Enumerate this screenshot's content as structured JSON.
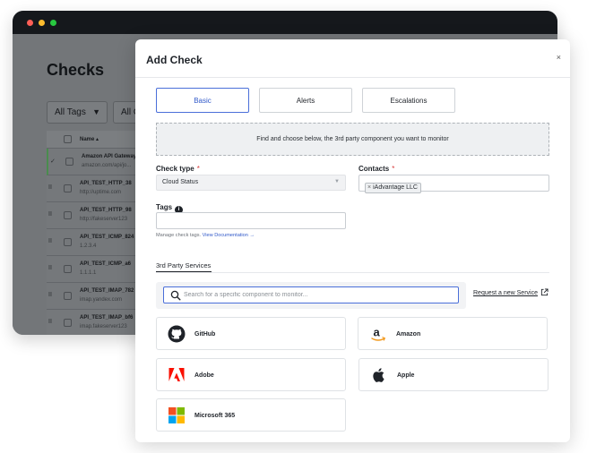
{
  "background_app": {
    "title": "Checks",
    "filter_all_tags": "All Tags",
    "filter_second": "All C",
    "table_header_name": "Name ▴",
    "rows": [
      {
        "name": "Amazon API Gateway",
        "sub": "amazon.com/api/jo...",
        "lead": "✓"
      },
      {
        "name": "API_TEST_HTTP_38",
        "sub": "http://uptime.com",
        "lead": "II"
      },
      {
        "name": "API_TEST_HTTP_98",
        "sub": "http://fakeserver123",
        "lead": "II"
      },
      {
        "name": "API_TEST_ICMP_824",
        "sub": "1.2.3.4",
        "lead": "II"
      },
      {
        "name": "API_TEST_ICMP_a6",
        "sub": "1.1.1.1",
        "lead": "II"
      },
      {
        "name": "API_TEST_IMAP_782",
        "sub": "imap.yandex.com",
        "lead": "II"
      },
      {
        "name": "API_TEST_IMAP_bf6",
        "sub": "imap.fakeserver123",
        "lead": "II"
      }
    ]
  },
  "modal": {
    "title": "Add Check",
    "close_symbol": "×",
    "tabs": [
      {
        "label": "Basic",
        "active": true
      },
      {
        "label": "Alerts",
        "active": false
      },
      {
        "label": "Escalations",
        "active": false
      }
    ],
    "dropzone_text": "Find and choose below, the 3rd party component you want to monitor",
    "check_type": {
      "label": "Check type",
      "required_mark": "*",
      "value": "Cloud Status"
    },
    "contacts": {
      "label": "Contacts",
      "required_mark": "*",
      "chip": "iAdvantage LLC",
      "chip_remove": "×"
    },
    "tags": {
      "label": "Tags",
      "info_symbol": "i",
      "value": ""
    },
    "helper_text": "Manage check tags.",
    "helper_link": "View Documentation →",
    "section_title": "3rd Party Services",
    "search": {
      "placeholder": "Search for a specific component to monitor..."
    },
    "request_link": "Request a new Service",
    "services": [
      {
        "name": "GitHub",
        "icon": "github-logo"
      },
      {
        "name": "Amazon",
        "icon": "amazon-logo"
      },
      {
        "name": "Adobe",
        "icon": "adobe-logo"
      },
      {
        "name": "Apple",
        "icon": "apple-logo"
      },
      {
        "name": "Microsoft 365",
        "icon": "microsoft-logo"
      }
    ]
  },
  "colors": {
    "accent": "#3159c9",
    "required": "#d83b3b",
    "adobe_red": "#fa0f00",
    "ms_red": "#f25022",
    "ms_green": "#7fba00",
    "ms_blue": "#00a4ef",
    "ms_yellow": "#ffb900"
  }
}
